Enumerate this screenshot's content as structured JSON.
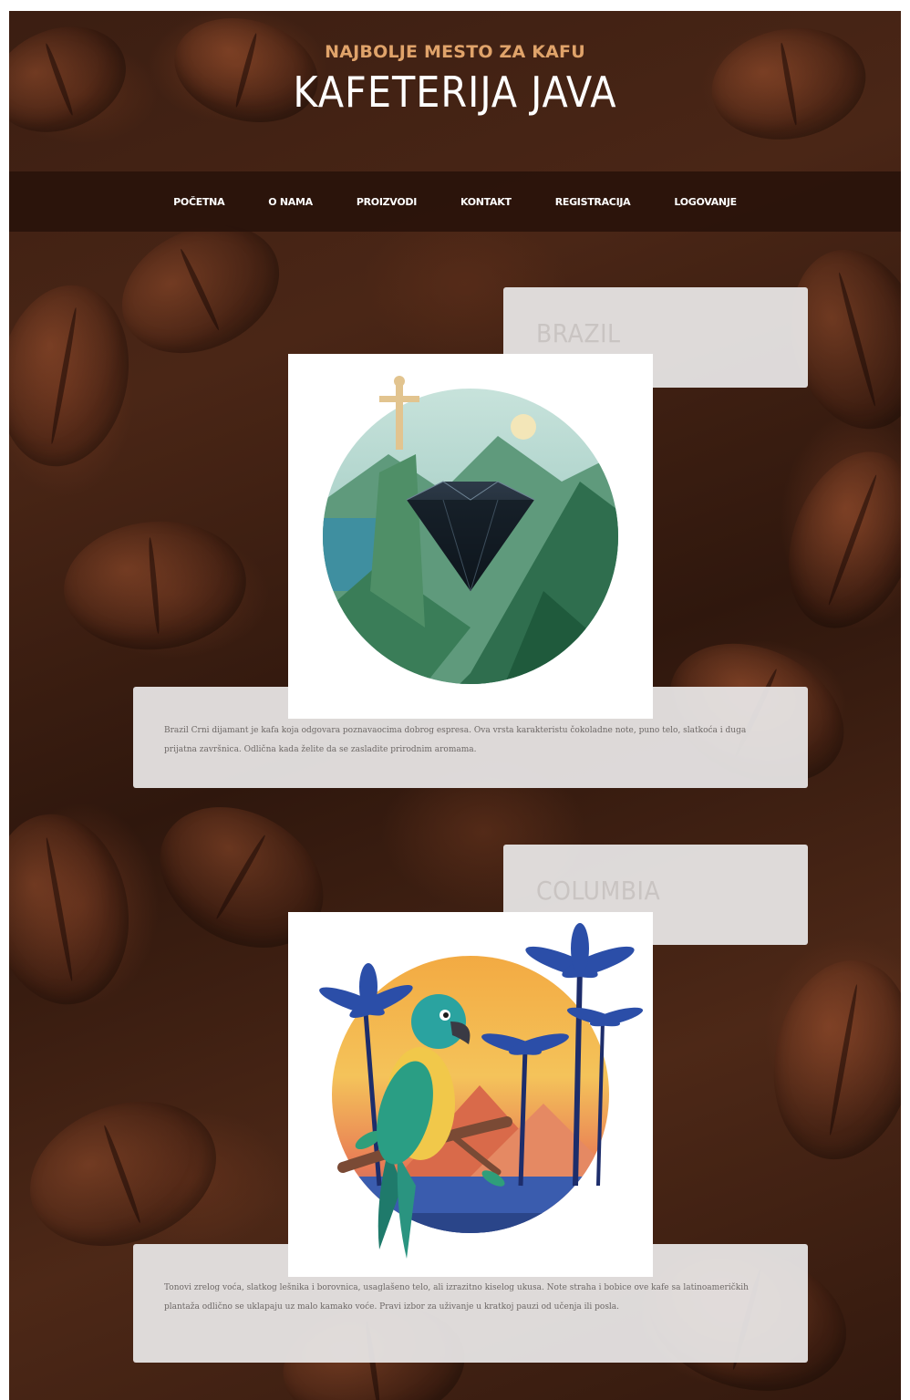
{
  "header": {
    "tagline": "NAJBOLJE MESTO ZA KAFU",
    "title": "KAFETERIJA JAVA"
  },
  "nav": {
    "items": [
      {
        "label": "POČETNA"
      },
      {
        "label": "O NAMA"
      },
      {
        "label": "PROIZVODI"
      },
      {
        "label": "KONTAKT"
      },
      {
        "label": "REGISTRACIJA"
      },
      {
        "label": "LOGOVANJE"
      }
    ]
  },
  "products": [
    {
      "name": "BRAZIL",
      "image_icon": "diamond-mountain-illustration-icon",
      "description": "Brazil Crni dijamant je kafa koja odgovara poznavaocima dobrog espresa. Ova vrsta karakteristu čokoladne note, puno telo, slatkoća i duga prijatna završnica. Odlična kada želite da se zasladite prirodnim aromama."
    },
    {
      "name": "COLUMBIA",
      "image_icon": "parrot-palm-illustration-icon",
      "description": "Tonovi zrelog voća, slatkog lešnika i borovnica, usaglašeno telo, ali izrazitno kiselog ukusa. Note straha i bobice ove kafe sa latinoameričkih plantaža odlično se uklapaju uz malo kamako voće. Pravi izbor za uživanje u kratkoj pauzi od učenja ili posla."
    }
  ],
  "colors": {
    "tagline": "#e0a36a",
    "title": "#ffffff",
    "navbar": "#28120a",
    "card": "#e8e6e6",
    "product_title": "#c9c4c2",
    "body_text": "#6d6866"
  }
}
